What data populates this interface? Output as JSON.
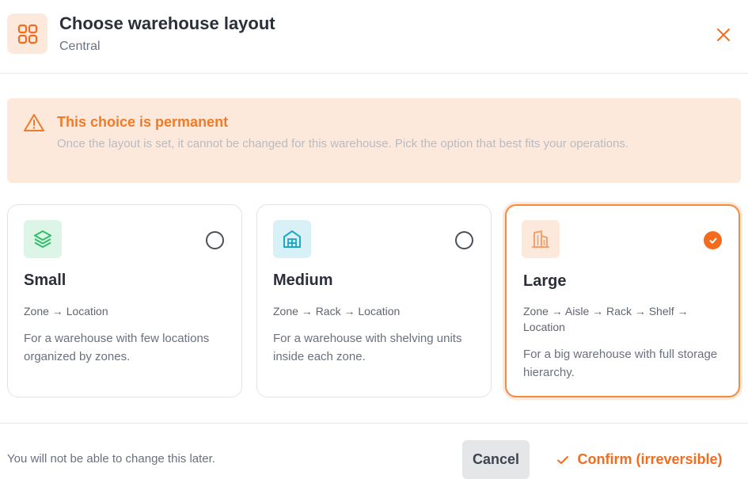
{
  "header": {
    "title": "Choose warehouse layout",
    "subtitle": "Central",
    "icon": "grid-icon",
    "close_icon": "close-icon"
  },
  "warning": {
    "icon": "warning-triangle-icon",
    "title": "This choice is permanent",
    "text": "Once the layout is set, it cannot be changed for this warehouse. Pick the option that best fits your operations."
  },
  "options": [
    {
      "title": "Small",
      "path": "Zone → Location",
      "description": "For a warehouse with few locations organized by zones.",
      "icon": "layers-icon",
      "selected": false
    },
    {
      "title": "Medium",
      "path": "Zone → Rack → Location",
      "description": "For a warehouse with shelving units inside each zone.",
      "icon": "warehouse-icon",
      "selected": false
    },
    {
      "title": "Large",
      "path": "Zone → Aisle → Rack → Shelf → Location",
      "description": "For a big warehouse with full storage hierarchy.",
      "icon": "building-icon",
      "selected": true
    }
  ],
  "footer": {
    "note": "You will not be able to change this later.",
    "cancel_label": "Cancel",
    "confirm_label": "Confirm (irreversible)",
    "confirm_icon": "check-icon"
  },
  "colors": {
    "accent": "#f36c1d",
    "accent_soft": "#fde9dc",
    "small_icon_bg": "#dcf5e6",
    "small_icon": "#2fbf6a",
    "medium_icon_bg": "#d7f1f7",
    "medium_icon": "#1fa7c7",
    "large_icon_bg": "#fde9dc",
    "large_icon": "#f4a06a"
  }
}
